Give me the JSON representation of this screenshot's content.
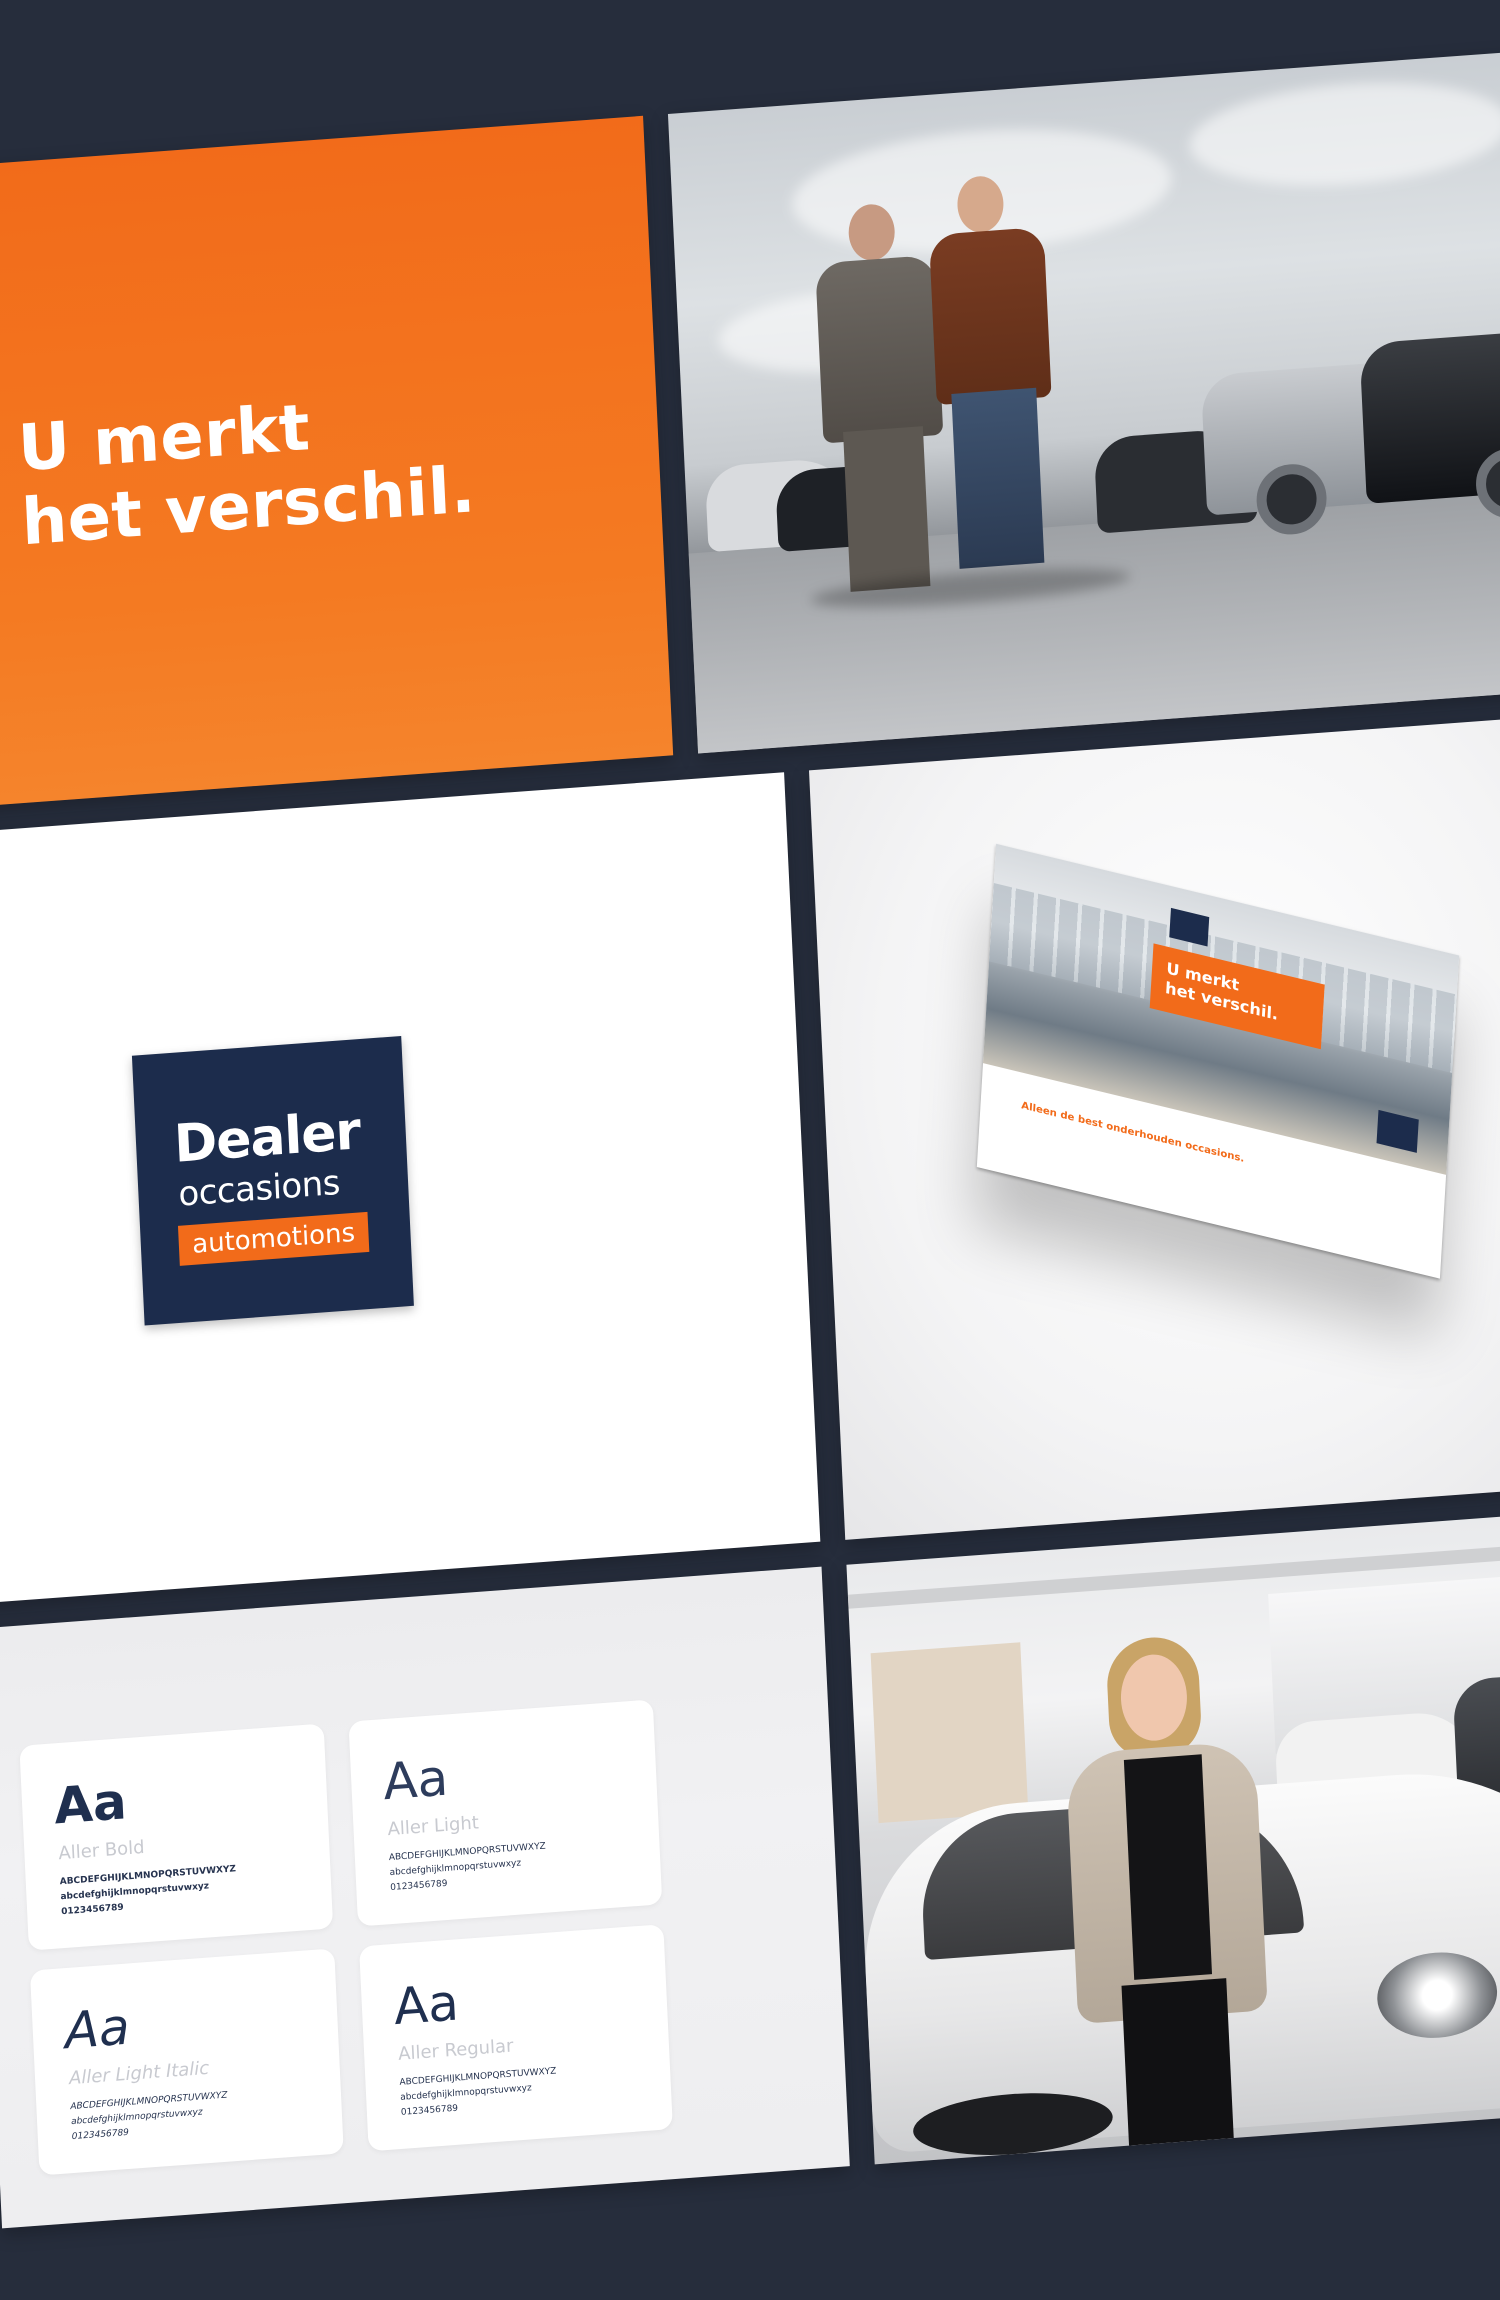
{
  "slogan": {
    "line1": "U merkt",
    "line2": "het verschil."
  },
  "logo": {
    "line1": "Dealer",
    "line2": "occasions",
    "badge": "automotions"
  },
  "brochure": {
    "banner_line1": "U merkt",
    "banner_line2": "het verschil.",
    "tagline": "Alleen de best onderhouden occasions."
  },
  "typography": [
    {
      "aa": "Aa",
      "name": "Aller Bold",
      "upper": "ABCDEFGHIJKLMNOPQRSTUVWXYZ",
      "lower": "abcdefghijklmnopqrstuvwxyz",
      "digits": "0123456789"
    },
    {
      "aa": "Aa",
      "name": "Aller Light",
      "upper": "ABCDEFGHIJKLMNOPQRSTUVWXYZ",
      "lower": "abcdefghijklmnopqrstuvwxyz",
      "digits": "0123456789"
    },
    {
      "aa": "Aa",
      "name": "Aller Light Italic",
      "upper": "ABCDEFGHIJKLMNOPQRSTUVWXYZ",
      "lower": "abcdefghijklmnopqrstuvwxyz",
      "digits": "0123456789"
    },
    {
      "aa": "Aa",
      "name": "Aller Regular",
      "upper": "ABCDEFGHIJKLMNOPQRSTUVWXYZ",
      "lower": "abcdefghijklmnopqrstuvwxyz",
      "digits": "0123456789"
    }
  ],
  "colors": {
    "brand_orange": "#f26b1a",
    "brand_navy": "#1c2c4c",
    "background": "#262d3c"
  }
}
